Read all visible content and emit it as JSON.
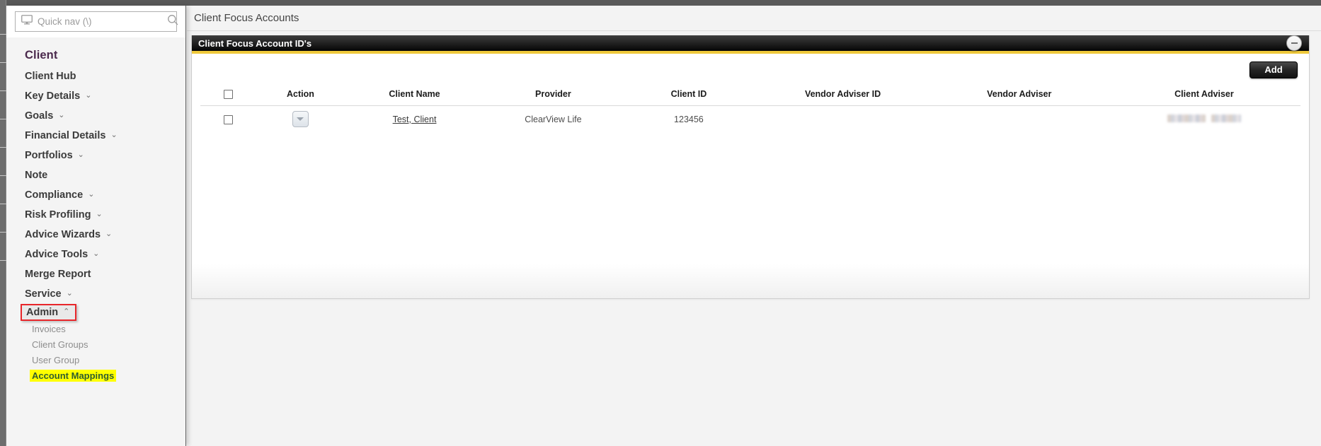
{
  "search": {
    "placeholder": "Quick nav (\\)",
    "value": "",
    "icon_left": "monitor-icon",
    "icon_right": "search-icon"
  },
  "sidebar": {
    "title": "Client",
    "items": [
      {
        "label": "Client Hub",
        "chevron": ""
      },
      {
        "label": "Key Details",
        "chevron": "⌄"
      },
      {
        "label": "Goals",
        "chevron": "⌄"
      },
      {
        "label": "Financial Details",
        "chevron": "⌄"
      },
      {
        "label": "Portfolios",
        "chevron": "⌄"
      },
      {
        "label": "Note",
        "chevron": ""
      },
      {
        "label": "Compliance",
        "chevron": "⌄"
      },
      {
        "label": "Risk Profiling",
        "chevron": "⌄"
      },
      {
        "label": "Advice Wizards",
        "chevron": "⌄"
      },
      {
        "label": "Advice Tools",
        "chevron": "⌄"
      },
      {
        "label": "Merge Report",
        "chevron": ""
      },
      {
        "label": "Service",
        "chevron": "⌄"
      }
    ],
    "admin": {
      "label": "Admin",
      "chevron": "⌃",
      "expanded": true
    },
    "admin_children": [
      {
        "label": "Invoices",
        "highlighted": false
      },
      {
        "label": "Client Groups",
        "highlighted": false
      },
      {
        "label": "User Group",
        "highlighted": false
      },
      {
        "label": "Account Mappings",
        "highlighted": true
      }
    ]
  },
  "header": {
    "title": "Client Focus Accounts"
  },
  "panel": {
    "title": "Client Focus Account ID's",
    "collapse_icon": "minus-circle-icon",
    "accent_color": "#efc93b",
    "header_color": "#111111"
  },
  "toolbar": {
    "add_label": "Add"
  },
  "table": {
    "columns": [
      "",
      "Action",
      "Client Name",
      "Provider",
      "Client ID",
      "Vendor Adviser ID",
      "Vendor Adviser",
      "Client Adviser"
    ],
    "rows": [
      {
        "selected": false,
        "client_name": "Test, Client",
        "provider": "ClearView Life",
        "client_id": "123456",
        "vendor_adviser_id": "",
        "vendor_adviser": "",
        "client_adviser": "",
        "client_adviser_redacted": true
      }
    ]
  }
}
